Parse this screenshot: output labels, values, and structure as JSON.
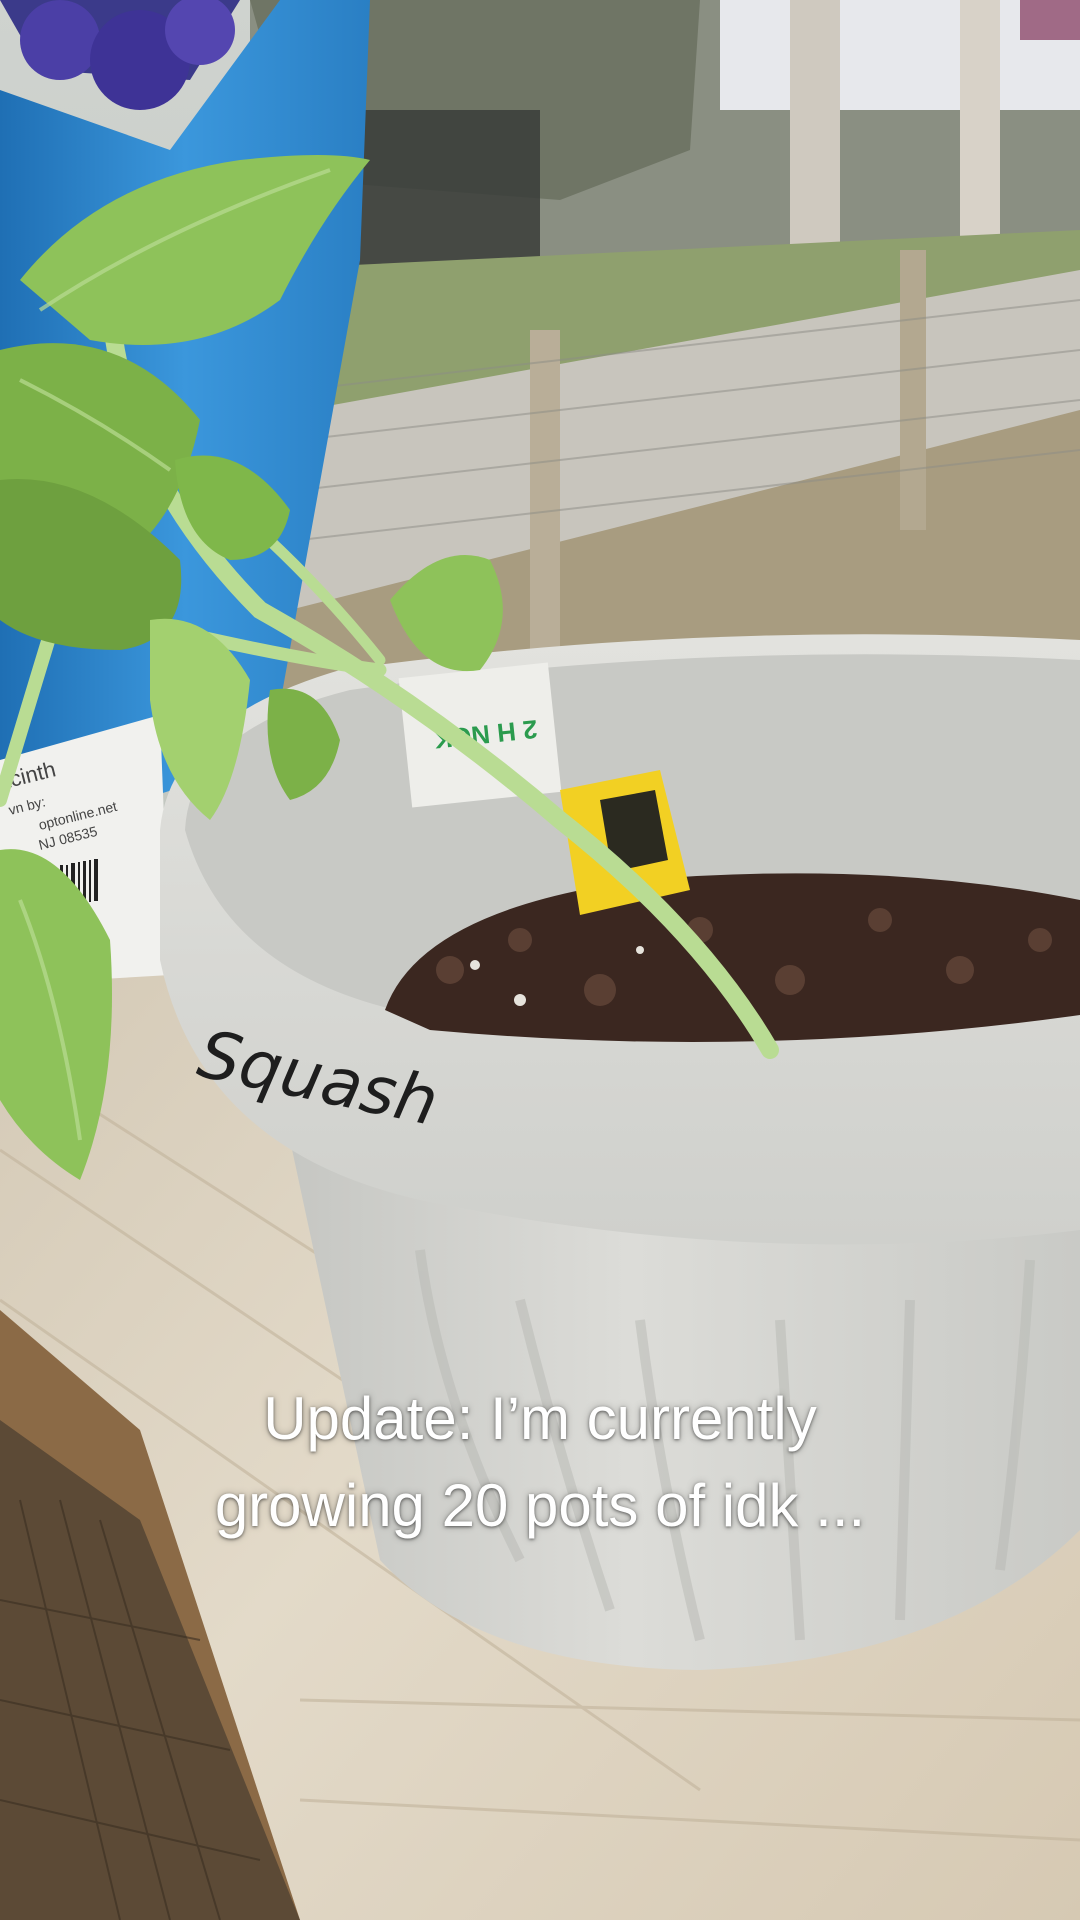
{
  "caption": {
    "line1": "Update: I’m currently",
    "line2": "growing 20 pots of idk ..."
  },
  "photo": {
    "pot_handwriting": "Squash",
    "seed_bag_text": [
      "acinth",
      "vn by:",
      "optonline.net",
      "NJ 08535"
    ],
    "pot_tag_text": "2 H NCK"
  },
  "colors": {
    "pot": "#d2d3cf",
    "soil": "#3b2720",
    "leaf": "#8ec25a",
    "stem": "#b9dc93",
    "bag_blue": "#2f8ad0",
    "tag_yellow": "#f2d023",
    "wood": "#ddd3c2",
    "caption_text": "#ffffff"
  }
}
